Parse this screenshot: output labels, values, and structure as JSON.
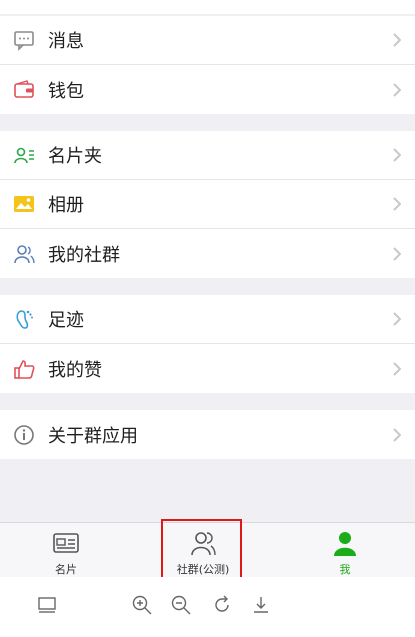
{
  "menu": {
    "group1": [
      {
        "label": "消息",
        "icon": "message-icon"
      },
      {
        "label": "钱包",
        "icon": "wallet-icon"
      }
    ],
    "group2": [
      {
        "label": "名片夹",
        "icon": "business-card-holder-icon"
      },
      {
        "label": "相册",
        "icon": "photo-album-icon"
      },
      {
        "label": "我的社群",
        "icon": "my-community-icon"
      }
    ],
    "group3": [
      {
        "label": "足迹",
        "icon": "footprint-icon"
      },
      {
        "label": "我的赞",
        "icon": "thumbs-up-icon"
      }
    ],
    "group4": [
      {
        "label": "关于群应用",
        "icon": "info-icon"
      }
    ]
  },
  "tabs": [
    {
      "label": "名片",
      "icon": "card-icon",
      "active": false
    },
    {
      "label": "社群(公测)",
      "icon": "community-icon",
      "active": false
    },
    {
      "label": "我",
      "icon": "me-icon",
      "active": true
    }
  ],
  "colors": {
    "accent": "#1aad19",
    "highlight": "#e01818",
    "background": "#efeff4"
  },
  "toolbar": {
    "icons": [
      "screen-icon",
      "zoom-in-icon",
      "zoom-out-icon",
      "rotate-icon",
      "download-icon"
    ]
  }
}
